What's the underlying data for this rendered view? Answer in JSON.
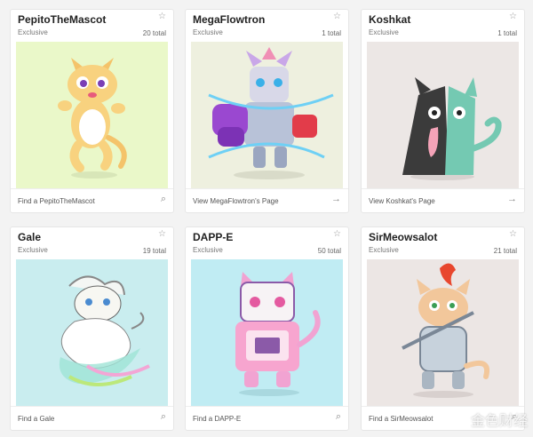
{
  "cards": [
    {
      "name": "PepitoTheMascot",
      "sub": "Exclusive",
      "total": "20 total",
      "link": "Find a PepitoTheMascot",
      "link_icon": "search-icon",
      "star_icon": "star-outline-icon",
      "bg": "#eaf8c9"
    },
    {
      "name": "MegaFlowtron",
      "sub": "Exclusive",
      "total": "1 total",
      "link": "View MegaFlowtron's Page",
      "link_icon": "arrow-right-icon",
      "star_icon": "star-outline-icon",
      "bg": "#eef0df"
    },
    {
      "name": "Koshkat",
      "sub": "Exclusive",
      "total": "1 total",
      "link": "View Koshkat's Page",
      "link_icon": "arrow-right-icon",
      "star_icon": "star-outline-icon",
      "bg": "#ece7e5"
    },
    {
      "name": "Gale",
      "sub": "Exclusive",
      "total": "19 total",
      "link": "Find a Gale",
      "link_icon": "search-icon",
      "star_icon": "star-outline-icon",
      "bg": "#c9edef"
    },
    {
      "name": "DAPP-E",
      "sub": "Exclusive",
      "total": "50 total",
      "link": "Find a DAPP-E",
      "link_icon": "search-icon",
      "star_icon": "star-outline-icon",
      "bg": "#c0ecf3"
    },
    {
      "name": "SirMeowsalot",
      "sub": "Exclusive",
      "total": "21 total",
      "link": "Find a SirMeowsalot",
      "link_icon": "search-icon",
      "star_icon": "star-outline-icon",
      "bg": "#ece6e4"
    }
  ],
  "watermark": "金色财经"
}
